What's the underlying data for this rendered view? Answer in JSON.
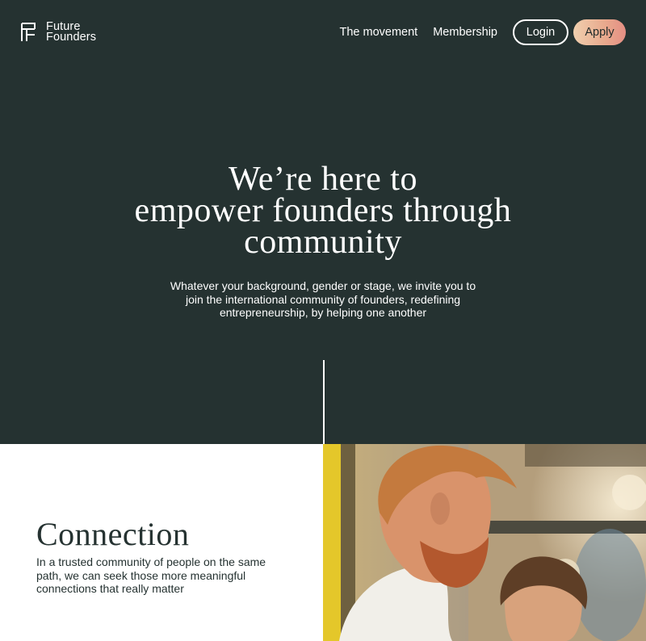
{
  "brand": {
    "logo_line1": "Future",
    "logo_line2": "Founders"
  },
  "nav": {
    "movement_label": "The movement",
    "membership_label": "Membership",
    "login_label": "Login",
    "apply_label": "Apply"
  },
  "hero": {
    "title_lines": [
      "We’re here to",
      "empower founders through",
      "community"
    ],
    "subtitle_lines": [
      "Whatever your background, gender or stage, we invite you to",
      "join the international community of founders, redefining",
      "entrepreneurship, by helping one another"
    ]
  },
  "connection": {
    "title": "Connection",
    "text_lines": [
      "In a trusted community of people on the same",
      "path, we can seek those more meaningful",
      "connections that really matter"
    ]
  },
  "colors": {
    "background": "#253231",
    "apply_gradient_start": "#f0cfae",
    "apply_gradient_end": "#e58f84",
    "text_light": "#ffffff",
    "text_dark": "#253231"
  }
}
